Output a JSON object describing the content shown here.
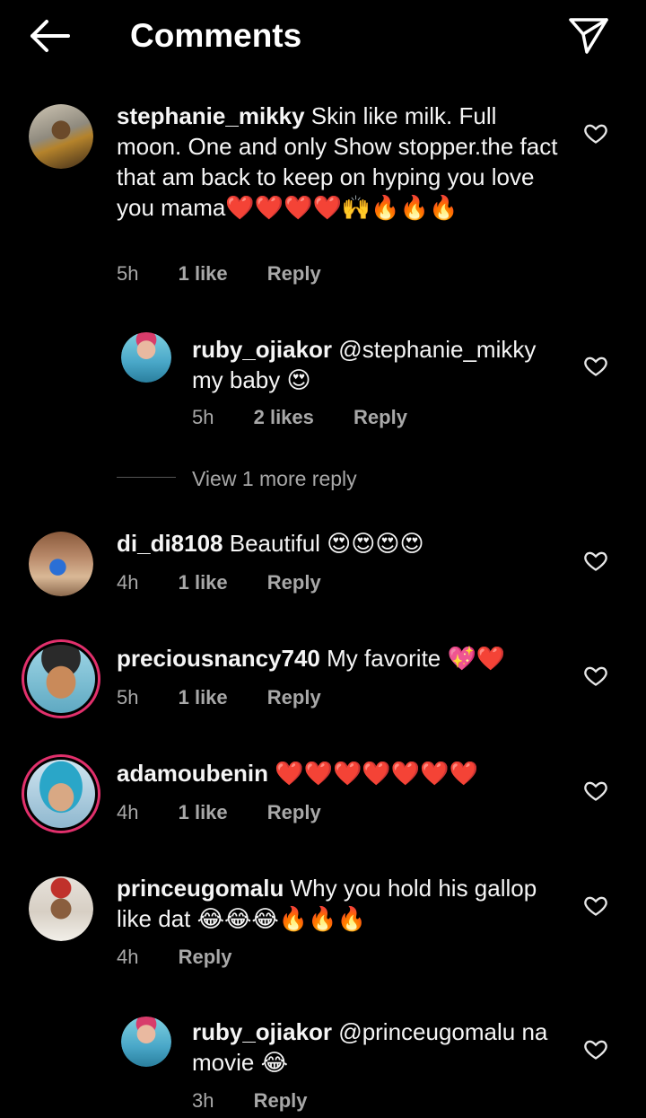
{
  "header": {
    "title": "Comments",
    "back_icon": "arrow-left-icon",
    "send_icon": "paper-plane-icon"
  },
  "comments": [
    {
      "username": "stephanie_mikky",
      "text": "Skin like milk.  Full moon.  One and only Show stopper.the fact that am back to keep on hyping you love you mama❤️❤️❤️❤️🙌🔥🔥🔥",
      "time": "5h",
      "likes": "1 like",
      "reply": "Reply"
    },
    {
      "username": "ruby_ojiakor",
      "text": "@stephanie_mikky my baby 😍",
      "time": "5h",
      "likes": "2 likes",
      "reply": "Reply"
    },
    {
      "username": "di_di8108",
      "text": "Beautiful 😍😍😍😍",
      "time": "4h",
      "likes": "1 like",
      "reply": "Reply"
    },
    {
      "username": "preciousnancy740",
      "text": "My favorite 💖❤️",
      "time": "5h",
      "likes": "1 like",
      "reply": "Reply"
    },
    {
      "username": "adamoubenin",
      "text": "❤️❤️❤️❤️❤️❤️❤️",
      "time": "4h",
      "likes": "1 like",
      "reply": "Reply"
    },
    {
      "username": "princeugomalu",
      "text": "Why you hold his gallop like dat 😂😂😂🔥🔥🔥",
      "time": "4h",
      "reply": "Reply"
    },
    {
      "username": "ruby_ojiakor",
      "text": "@princeugomalu na movie 😂",
      "time": "3h",
      "reply": "Reply"
    }
  ],
  "view_more": "View 1 more reply",
  "icons": {
    "heart": "heart-outline-icon"
  },
  "colors": {
    "background": "#000000",
    "story_ring": "#e1306c",
    "meta_text": "#a8a8a8"
  }
}
